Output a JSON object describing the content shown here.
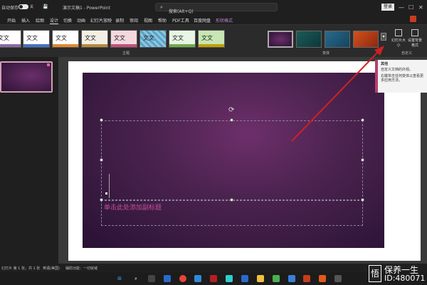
{
  "titlebar": {
    "autosave": "自动保存",
    "toggle_state": "关",
    "doc_title": "演示文稿1 - PowerPoint",
    "search_placeholder": "搜索(Alt+Q)",
    "login": "登录",
    "minimize": "—",
    "maximize": "☐",
    "close": "✕"
  },
  "tabs": [
    "开始",
    "插入",
    "绘图",
    "设计",
    "切换",
    "动画",
    "幻灯片放映",
    "录制",
    "审阅",
    "视图",
    "帮助",
    "PDF工具",
    "百度网盘"
  ],
  "active_tab": "设计",
  "context_tab": "形状格式",
  "ribbon": {
    "themes_group": "主题",
    "variants_group": "变体",
    "customize_group": "自定义",
    "theme_samples": [
      "文文",
      "文文",
      "文文",
      "文文",
      "文文",
      "文文",
      "文文",
      "文文"
    ],
    "slide_size": "幻灯片大小",
    "format_bg": "设置背景格式"
  },
  "tooltip": {
    "title": "其他",
    "line1": "自定义文档的外观。",
    "line2": "右键单击任何变体以查看更多应用方法。"
  },
  "slide": {
    "subtitle_placeholder": "单击此处添加副标题"
  },
  "statusbar": {
    "slide_count": "幻灯片 第 1 张，共 1 张",
    "language": "英语(美国)",
    "accessibility": "辅助功能：一切就绪"
  },
  "watermark": {
    "logo": "悟",
    "line1": "保养一生",
    "line2": "ID:480071"
  },
  "colors": {
    "accent": "#c43e1c",
    "slide_bg": "#4b234f",
    "subtitle": "#c64f9a",
    "arrow": "#cc2222"
  }
}
